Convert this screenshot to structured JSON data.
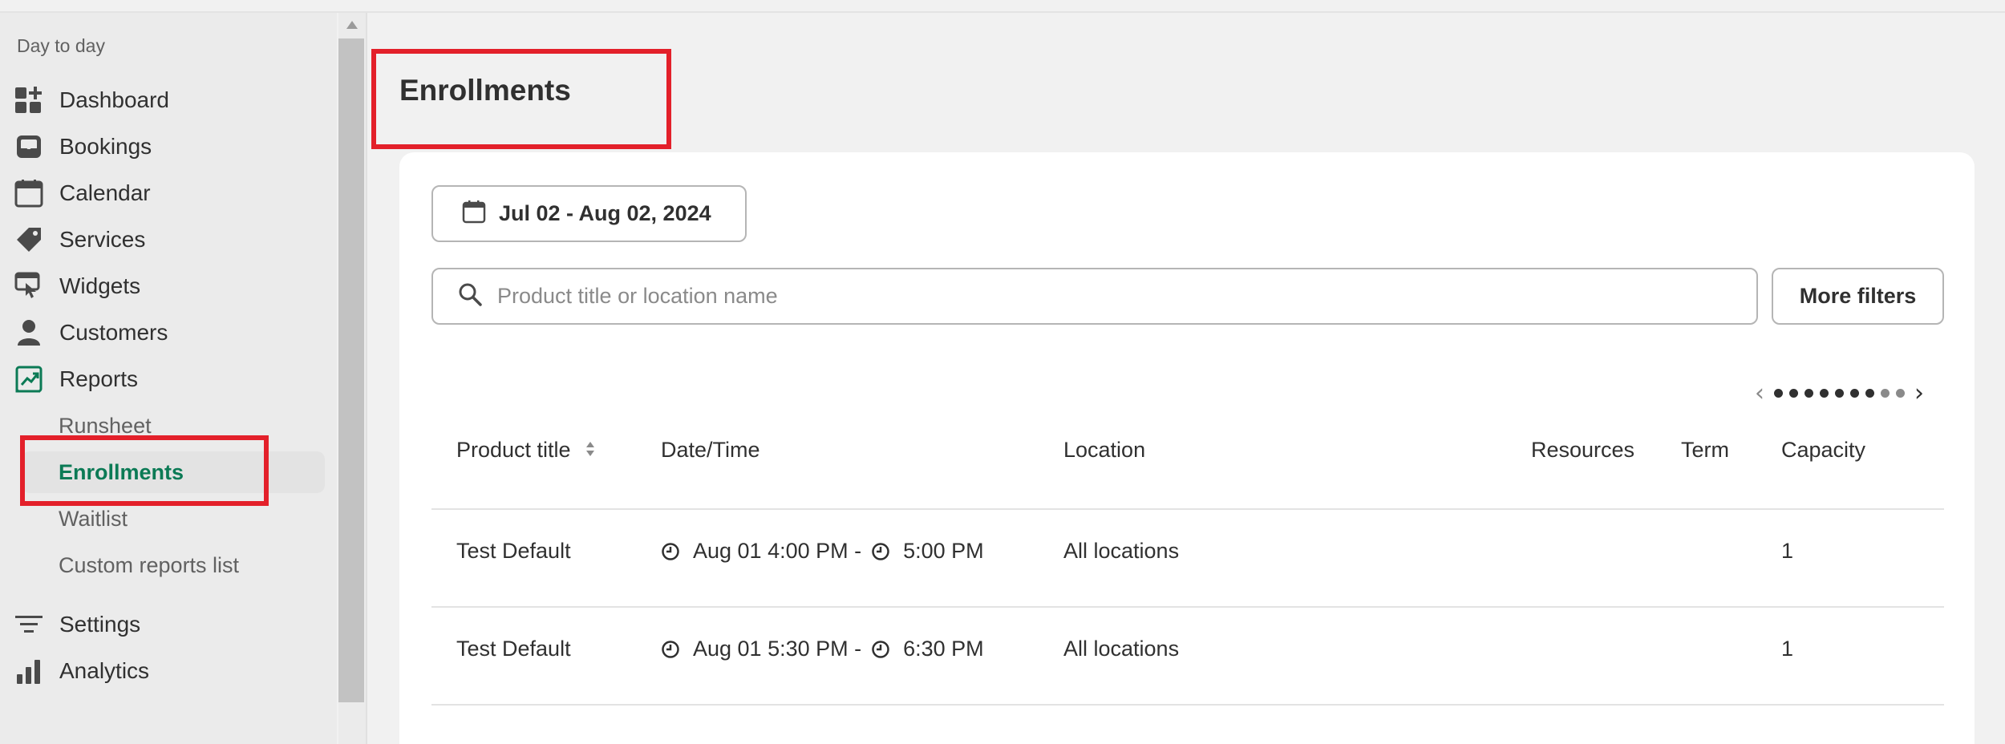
{
  "sidebar": {
    "section_label": "Day to day",
    "items": [
      {
        "label": "Dashboard",
        "icon": "dashboard-icon"
      },
      {
        "label": "Bookings",
        "icon": "inbox-icon"
      },
      {
        "label": "Calendar",
        "icon": "calendar-icon"
      },
      {
        "label": "Services",
        "icon": "tag-icon"
      },
      {
        "label": "Widgets",
        "icon": "widget-icon"
      },
      {
        "label": "Customers",
        "icon": "person-icon"
      },
      {
        "label": "Reports",
        "icon": "reports-icon"
      }
    ],
    "report_subitems": [
      {
        "label": "Runsheet"
      },
      {
        "label": "Enrollments",
        "active": true
      },
      {
        "label": "Waitlist"
      },
      {
        "label": "Custom reports list"
      }
    ],
    "bottom_items": [
      {
        "label": "Settings",
        "icon": "filter-settings-icon"
      },
      {
        "label": "Analytics",
        "icon": "bar-chart-icon"
      }
    ]
  },
  "page": {
    "title": "Enrollments"
  },
  "filters": {
    "date_range": "Jul 02 - Aug 02, 2024",
    "search_placeholder": "Product title or location name",
    "more_filters": "More filters"
  },
  "table": {
    "columns": [
      "Product title",
      "Date/Time",
      "Location",
      "Resources",
      "Term",
      "Capacity"
    ],
    "rows": [
      {
        "product": "Test Default",
        "date": "Aug 01 4:00 PM -",
        "end_time": "5:00 PM",
        "location": "All locations",
        "resources": "",
        "term": "",
        "capacity": "1"
      },
      {
        "product": "Test Default",
        "date": "Aug 01 5:30 PM -",
        "end_time": "6:30 PM",
        "location": "All locations",
        "resources": "",
        "term": "",
        "capacity": "1"
      }
    ]
  },
  "colors": {
    "accent_active": "#0b7a55",
    "highlight": "#e3202a"
  }
}
